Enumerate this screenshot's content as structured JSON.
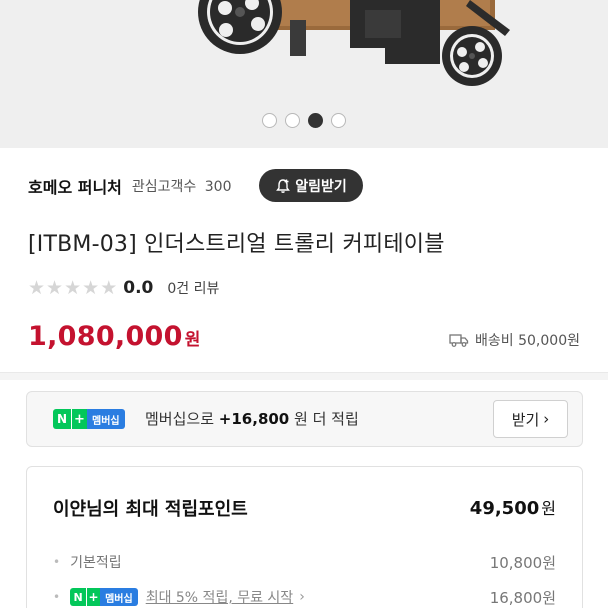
{
  "gallery": {
    "slide_count": 4,
    "active_index": 2
  },
  "store": {
    "name": "호메오 퍼니처",
    "fans_label": "관심고객수",
    "fans_count": "300",
    "alarm_button": "알림받기"
  },
  "product": {
    "title": "[ITBM-03] 인더스트리얼 트롤리 커피테이블",
    "rating_score": "0.0",
    "rating_stars": 0,
    "review_count": "0건 리뷰",
    "price": "1,080,000",
    "price_unit": "원",
    "shipping": "배송비 50,000원"
  },
  "membership": {
    "badge_n": "N",
    "badge_plus": "+",
    "badge_label": "멤버십",
    "text_prefix": "멤버십으로",
    "text_points": "+16,800",
    "text_suffix": "원 더 적립",
    "button": "받기"
  },
  "points": {
    "title": "이얀님의 최대 적립포인트",
    "total": "49,500",
    "total_unit": "원",
    "rows": [
      {
        "label": "기본적립",
        "value": "10,800원"
      },
      {
        "label": "최대 5% 적립, 무료 시작",
        "value": "16,800원"
      }
    ]
  },
  "colors": {
    "price": "#c4122f",
    "naver_green": "#03c75a",
    "membership_blue": "#2a7de1",
    "dark_button": "#333333"
  }
}
